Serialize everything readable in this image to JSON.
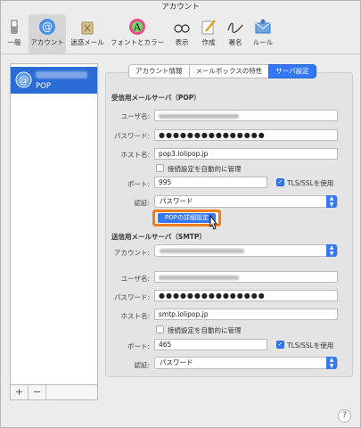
{
  "window": {
    "title": "アカウント"
  },
  "toolbar": {
    "items": [
      {
        "label": "一般",
        "icon": "switch-icon"
      },
      {
        "label": "アカウント",
        "icon": "at-sign-icon",
        "active": true
      },
      {
        "label": "迷惑メール",
        "icon": "junk-trash-icon"
      },
      {
        "label": "フォントとカラー",
        "icon": "font-color-icon"
      },
      {
        "label": "表示",
        "icon": "glasses-icon"
      },
      {
        "label": "作成",
        "icon": "compose-pencil-icon"
      },
      {
        "label": "署名",
        "icon": "signature-icon"
      },
      {
        "label": "ルール",
        "icon": "rules-envelope-icon"
      }
    ]
  },
  "sidebar": {
    "account": {
      "type": "POP",
      "icon": "at-sign-icon"
    },
    "add_label": "+",
    "remove_label": "−"
  },
  "tabs": [
    "アカウント情報",
    "メールボックスの特性",
    "サーバ設定"
  ],
  "active_tab": "サーバ設定",
  "incoming": {
    "section_title": "受信用メールサーバ（POP）",
    "username_label": "ユーザ名:",
    "password_label": "パスワード:",
    "password_value": "●●●●●●●●●●●●●●●",
    "host_label": "ホスト名:",
    "host_value": "pop3.lolipop.jp",
    "auto_manage_label": "接続設定を自動的に管理",
    "port_label": "ポート:",
    "port_value": "995",
    "tls_label": "TLS/SSLを使用",
    "auth_label": "認証:",
    "auth_value": "パスワード",
    "advanced_button": "POPの詳細設定"
  },
  "outgoing": {
    "section_title": "送信用メールサーバ（SMTP）",
    "account_label": "アカウント:",
    "username_label": "ユーザ名:",
    "password_label": "パスワード:",
    "password_value": "●●●●●●●●●●●●●●●",
    "host_label": "ホスト名:",
    "host_value": "smtp.lolipop.jp",
    "auto_manage_label": "接続設定を自動的に管理",
    "port_label": "ポート:",
    "port_value": "465",
    "tls_label": "TLS/SSLを使用",
    "auth_label": "認証:",
    "auth_value": "パスワード"
  },
  "help_label": "?",
  "colors": {
    "accent": "#3478f6",
    "highlight": "#ef7e1a",
    "selection": "#2a6bd6"
  }
}
